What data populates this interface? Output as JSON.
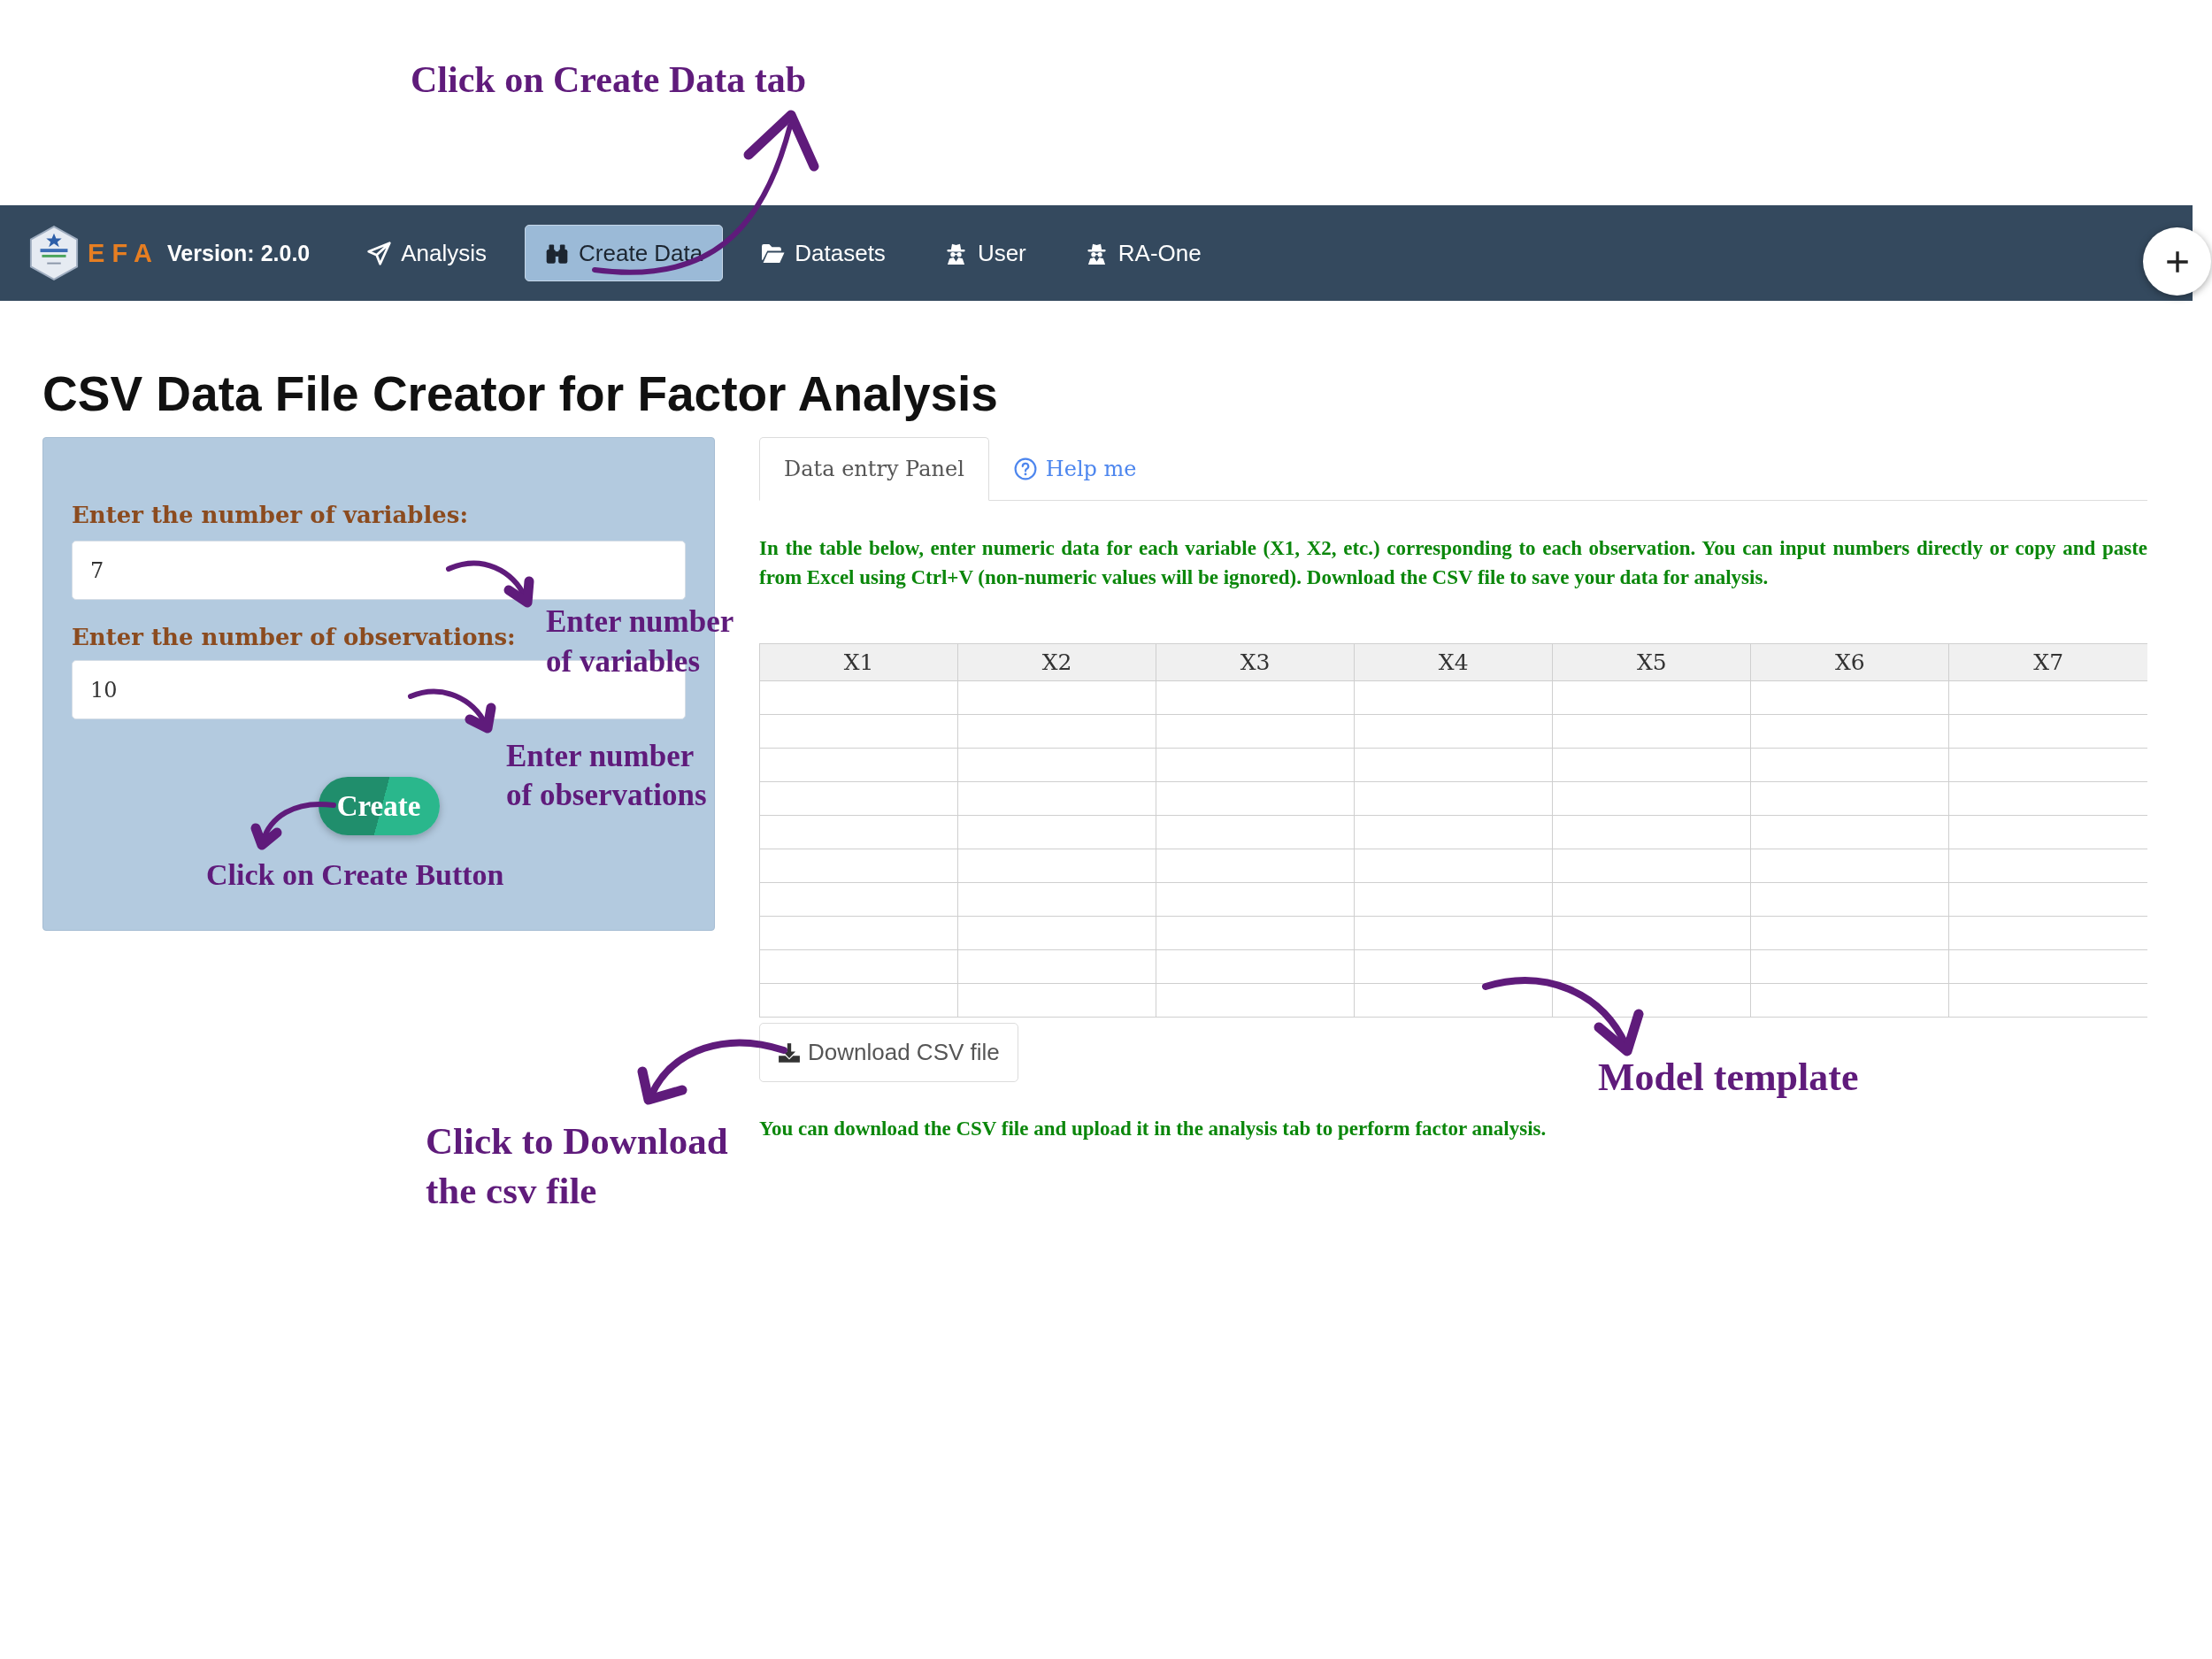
{
  "annotations": [
    {
      "text": "Click on Create Data tab"
    },
    {
      "text": "Enter number\nof variables"
    },
    {
      "text": "Enter number\nof observations"
    },
    {
      "text": "Click on Create Button"
    },
    {
      "text": "Click to Download\nthe csv file"
    },
    {
      "text": "Model template"
    }
  ],
  "navbar": {
    "brand": "E F A",
    "version": "Version: 2.0.0",
    "items": [
      {
        "label": "Analysis",
        "selected": false
      },
      {
        "label": "Create Data",
        "selected": true
      },
      {
        "label": "Datasets",
        "selected": false
      },
      {
        "label": "User",
        "selected": false
      },
      {
        "label": "RA-One",
        "selected": false
      }
    ]
  },
  "page_title": "CSV Data File Creator for Factor Analysis",
  "form": {
    "fields": [
      {
        "label": "Enter the number of variables:",
        "value": "7"
      },
      {
        "label": "Enter the number of observations:",
        "value": "10"
      }
    ],
    "create_button": "Create"
  },
  "tabs": [
    {
      "label": "Data entry Panel",
      "selected": true
    },
    {
      "label": "Help me",
      "selected": false
    }
  ],
  "instructions": "In the table below, enter numeric data for each variable (X1, X2, etc.) corresponding to each observation. You can input numbers directly or copy and paste from Excel using Ctrl+V (non-numeric values will be ignored). Download the CSV file to save your data for analysis.",
  "table": {
    "columns": [
      "X1",
      "X2",
      "X3",
      "X4",
      "X5",
      "X6",
      "X7"
    ]
  },
  "download_button": "Download CSV file",
  "note": "You can download the CSV file and upload it in the analysis tab to perform factor analysis."
}
